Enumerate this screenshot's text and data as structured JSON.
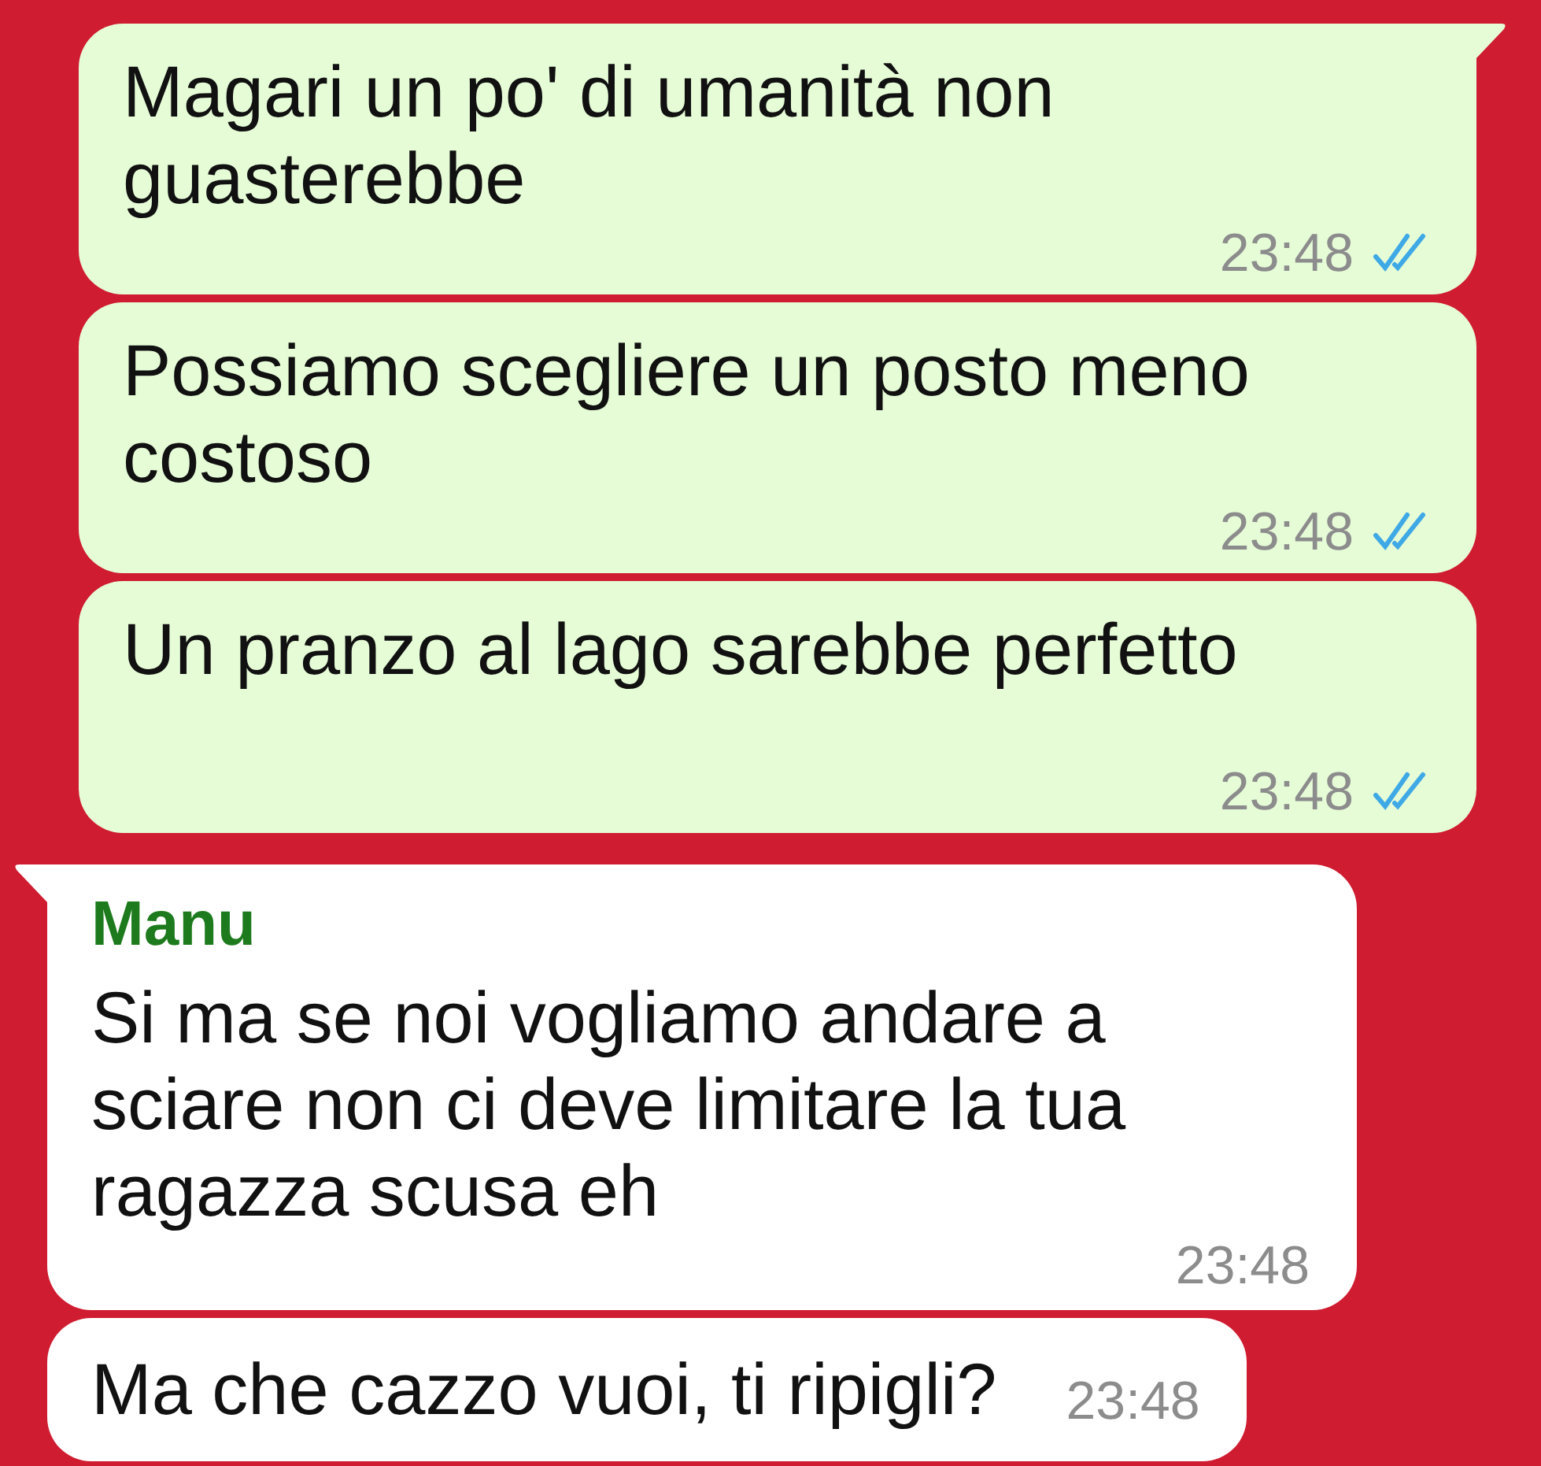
{
  "messages": [
    {
      "kind": "outgoing",
      "tail": true,
      "text": "Magari un po' di umanità non guasterebbe",
      "time": "23:48",
      "read": true
    },
    {
      "kind": "outgoing",
      "tail": false,
      "text": "Possiamo scegliere un posto meno costoso",
      "time": "23:48",
      "read": true
    },
    {
      "kind": "outgoing",
      "tail": false,
      "text": "Un pranzo al lago sarebbe perfetto",
      "time": "23:48",
      "read": true
    },
    {
      "kind": "incoming",
      "tail": true,
      "sender": "Manu",
      "text": "Si ma se noi vogliamo andare a sciare non ci deve limitare la tua ragazza scusa eh",
      "time": "23:48"
    },
    {
      "kind": "incoming",
      "tail": false,
      "text": "Ma che cazzo vuoi, ti ripigli?",
      "time": "23:48"
    }
  ]
}
